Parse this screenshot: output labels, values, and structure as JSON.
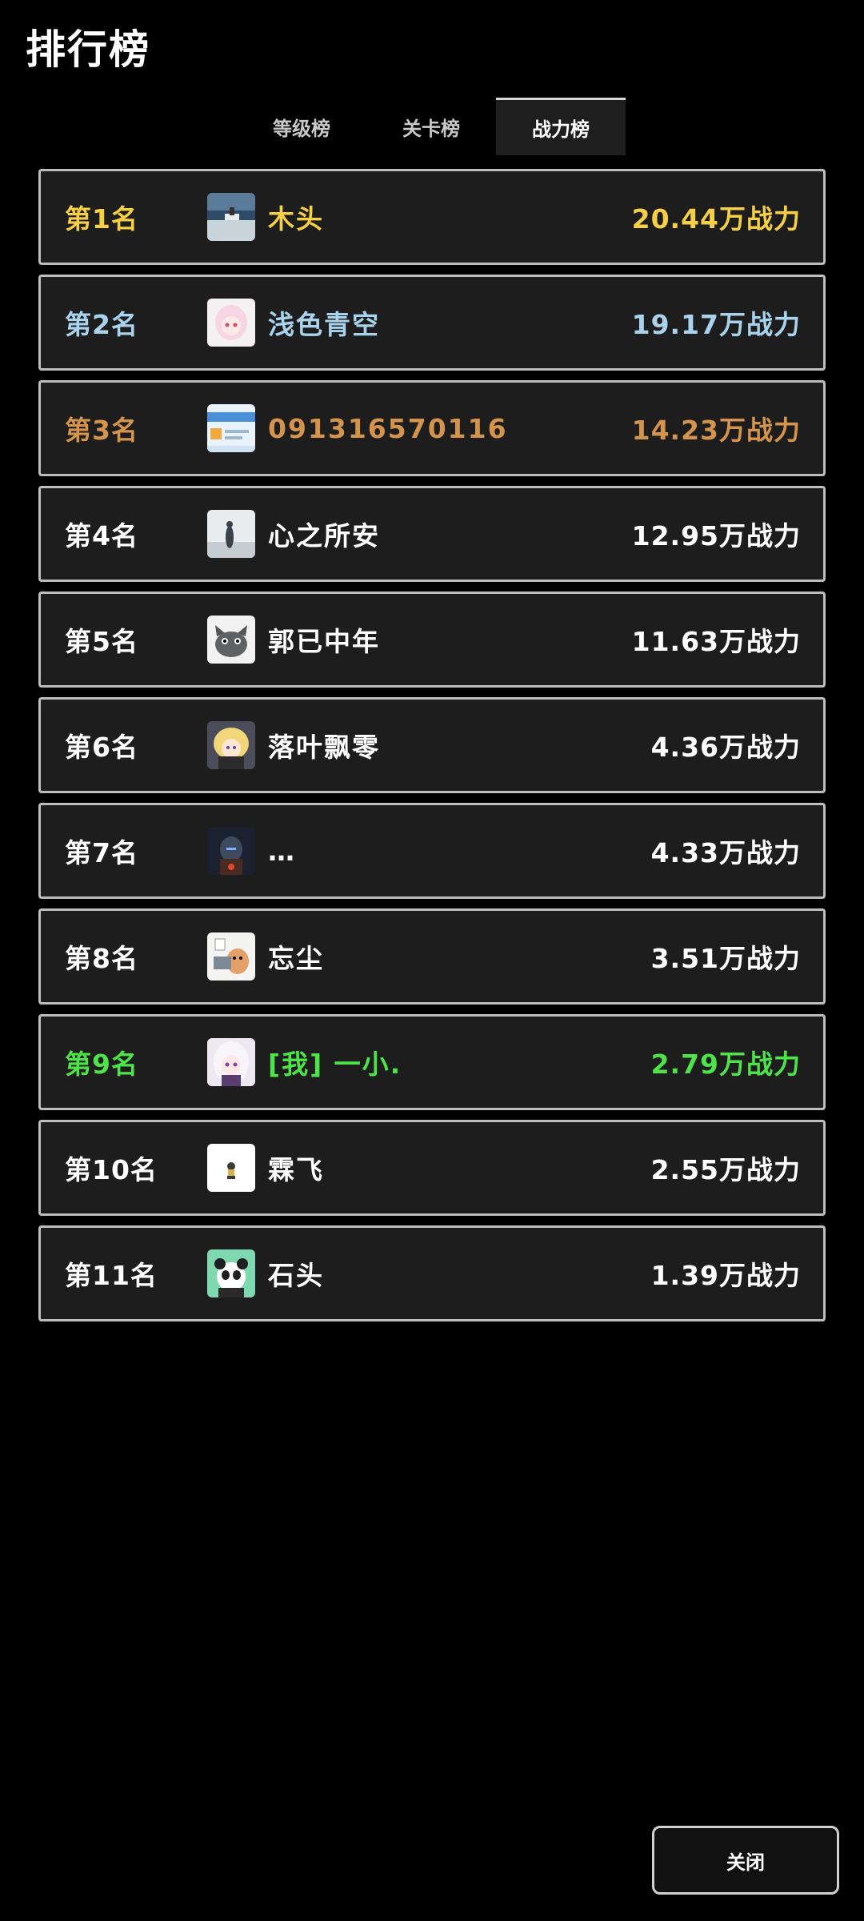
{
  "page": {
    "title": "排行榜"
  },
  "tabs": [
    {
      "label": "等级榜",
      "active": false
    },
    {
      "label": "关卡榜",
      "active": false
    },
    {
      "label": "战力榜",
      "active": true
    }
  ],
  "colors": {
    "gold": "#f5cf45",
    "silver": "#a9d3ec",
    "bronze": "#d4944e",
    "default": "#ffffff",
    "self": "#4fe34a"
  },
  "rankings": [
    {
      "rank": "第1名",
      "name": "木头",
      "power": "20.44万战力",
      "tier": "gold",
      "avatar": "boat-landscape-avatar-icon"
    },
    {
      "rank": "第2名",
      "name": "浅色青空",
      "power": "19.17万战力",
      "tier": "silver",
      "avatar": "anime-girl-avatar-icon"
    },
    {
      "rank": "第3名",
      "name": "091316570116",
      "power": "14.23万战力",
      "tier": "bronze",
      "avatar": "screenshot-avatar-icon"
    },
    {
      "rank": "第4名",
      "name": "心之所安",
      "power": "12.95万战力",
      "tier": "default",
      "avatar": "ink-figure-avatar-icon"
    },
    {
      "rank": "第5名",
      "name": "郭已中年",
      "power": "11.63万战力",
      "tier": "default",
      "avatar": "wolf-cartoon-avatar-icon"
    },
    {
      "rank": "第6名",
      "name": "落叶飘零",
      "power": "4.36万战力",
      "tier": "default",
      "avatar": "anime-blonde-avatar-icon"
    },
    {
      "rank": "第7名",
      "name": "…",
      "power": "4.33万战力",
      "tier": "default",
      "avatar": "armored-hero-avatar-icon"
    },
    {
      "rank": "第8名",
      "name": "忘尘",
      "power": "3.51万战力",
      "tier": "default",
      "avatar": "cat-cartoon-avatar-icon"
    },
    {
      "rank": "第9名",
      "name": "[我] 一小.",
      "power": "2.79万战力",
      "tier": "self",
      "avatar": "anime-white-hair-avatar-icon"
    },
    {
      "rank": "第10名",
      "name": "霖飞",
      "power": "2.55万战力",
      "tier": "default",
      "avatar": "small-figure-avatar-icon"
    },
    {
      "rank": "第11名",
      "name": "石头",
      "power": "1.39万战力",
      "tier": "default",
      "avatar": "panda-avatar-icon"
    }
  ],
  "footer": {
    "close_label": "关闭"
  }
}
